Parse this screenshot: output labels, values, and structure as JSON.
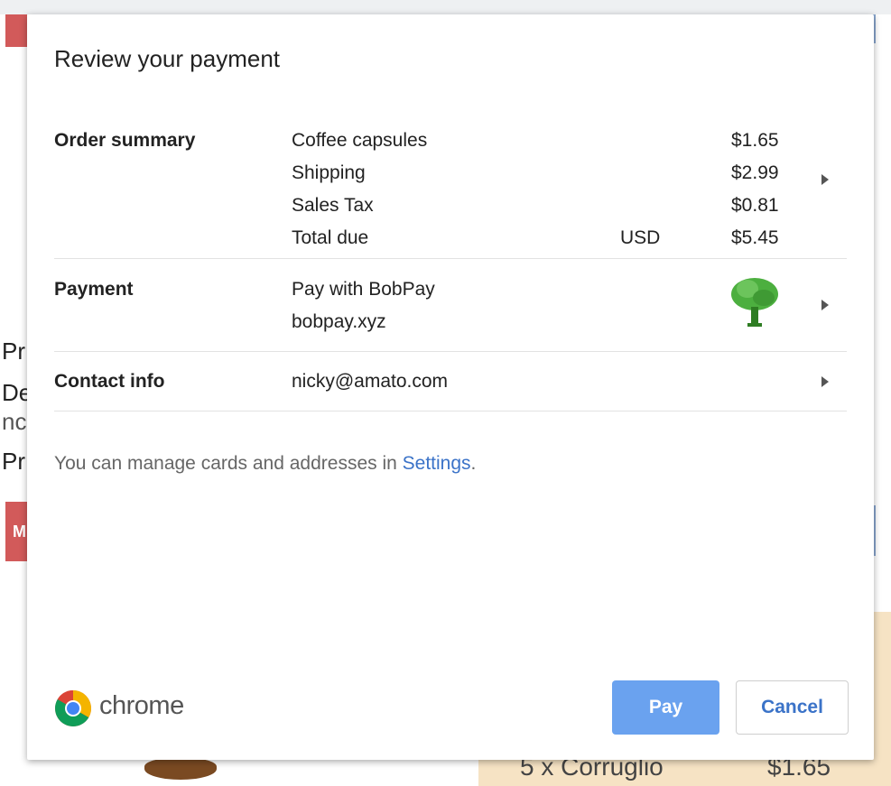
{
  "background": {
    "letters": [
      "Pr",
      "De",
      "nc",
      "Pr"
    ],
    "red_badge_letter": "M",
    "cart_item": "5 x Corruglio",
    "cart_price": "$1.65"
  },
  "dialog": {
    "title": "Review your payment",
    "order_summary": {
      "label": "Order summary",
      "items": [
        {
          "name": "Coffee capsules",
          "currency": "",
          "amount": "$1.65"
        },
        {
          "name": "Shipping",
          "currency": "",
          "amount": "$2.99"
        },
        {
          "name": "Sales Tax",
          "currency": "",
          "amount": "$0.81"
        },
        {
          "name": "Total due",
          "currency": "USD",
          "amount": "$5.45"
        }
      ]
    },
    "payment": {
      "label": "Payment",
      "method": "Pay with BobPay",
      "origin": "bobpay.xyz",
      "icon": "tree-icon"
    },
    "contact": {
      "label": "Contact info",
      "email": "nicky@amato.com"
    },
    "manage_text": "You can manage cards and addresses in ",
    "settings_link": "Settings",
    "manage_suffix": ".",
    "brand": "chrome",
    "pay_label": "Pay",
    "cancel_label": "Cancel"
  },
  "colors": {
    "pay_button": "#6aa2ef",
    "link": "#3b73c8",
    "badge_red": "#d25a5a",
    "cart_bg": "#f6e3c4"
  }
}
